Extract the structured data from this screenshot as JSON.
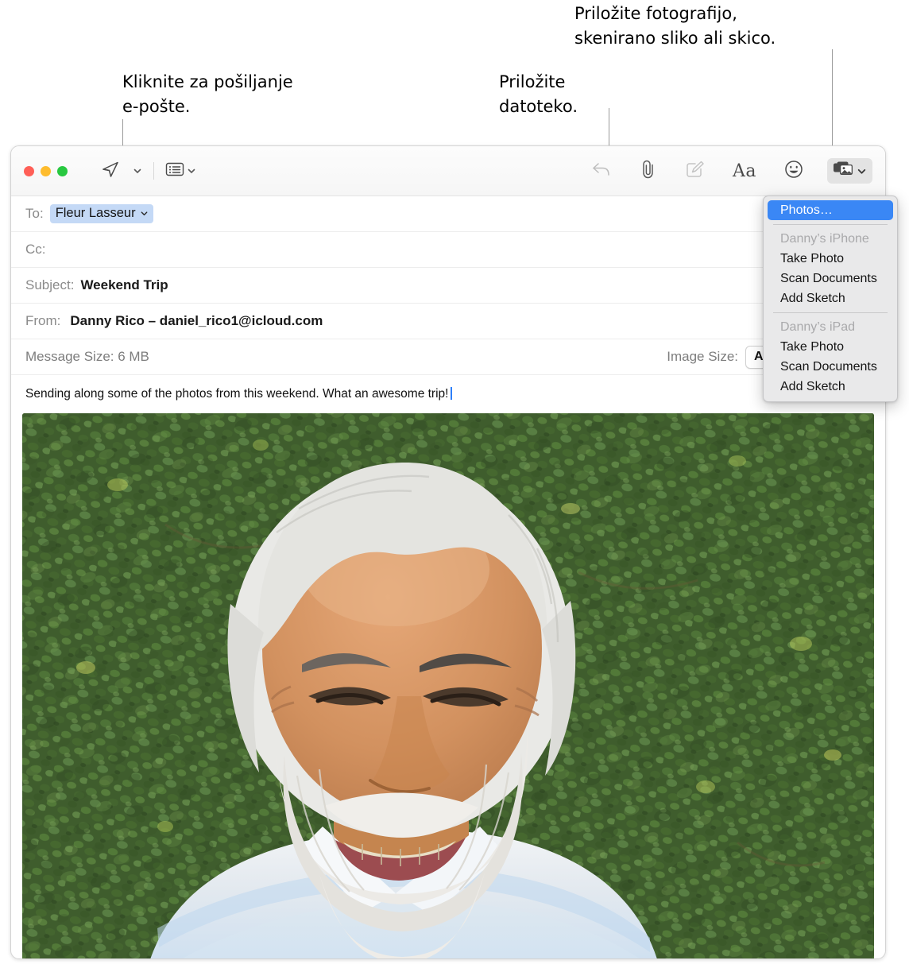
{
  "callouts": [
    {
      "id": "send",
      "text": "Kliknite za pošiljanje\ne-pošte."
    },
    {
      "id": "file",
      "text": "Priložite\ndatoteko."
    },
    {
      "id": "photo",
      "text": "Priložite fotografijo,\nskenirano sliko ali skico."
    }
  ],
  "window": {
    "traffic_lights": [
      {
        "name": "close",
        "color": "#ff5f57"
      },
      {
        "name": "minimize",
        "color": "#febc2e"
      },
      {
        "name": "zoom",
        "color": "#28c840"
      }
    ],
    "toolbar": {
      "send_icon": "send-paper-plane-icon",
      "send_chevron_icon": "chevron-down-icon",
      "stationery_icon": "stationery-list-icon",
      "stationery_chevron_icon": "chevron-down-icon",
      "reply_icon": "reply-arrow-icon",
      "attach_icon": "paperclip-icon",
      "markup_icon": "markup-pencil-icon",
      "format_label": "Aa",
      "emoji_icon": "smiley-face-icon",
      "photo_browser_icon": "photo-stack-icon",
      "photo_browser_chevron_icon": "chevron-down-icon"
    }
  },
  "compose": {
    "to": {
      "label": "To:",
      "token": "Fleur Lasseur",
      "token_chevron_icon": "chevron-down-icon"
    },
    "cc": {
      "label": "Cc:",
      "value": ""
    },
    "subject": {
      "label": "Subject:",
      "value": "Weekend Trip"
    },
    "from": {
      "label": "From:",
      "value": "Danny Rico – daniel_rico1@icloud.com"
    },
    "message_size": {
      "label": "Message Size: 6 MB"
    },
    "image_size": {
      "label": "Image Size:",
      "value": "Actual Size"
    },
    "body_text": "Sending along some of the photos from this weekend. What an awesome trip!",
    "attachment_name": "photo-attachment"
  },
  "photo_menu": {
    "items": [
      {
        "label": "Photos…",
        "type": "item",
        "selected": true
      },
      {
        "type": "separator"
      },
      {
        "label": "Danny’s iPhone",
        "type": "header"
      },
      {
        "label": "Take Photo",
        "type": "item"
      },
      {
        "label": "Scan Documents",
        "type": "item"
      },
      {
        "label": "Add Sketch",
        "type": "item"
      },
      {
        "type": "separator"
      },
      {
        "label": "Danny’s iPad",
        "type": "header"
      },
      {
        "label": "Take Photo",
        "type": "item"
      },
      {
        "label": "Scan Documents",
        "type": "item"
      },
      {
        "label": "Add Sketch",
        "type": "item"
      }
    ]
  },
  "colors": {
    "accent": "#3a87f5",
    "token_bg": "#c4d9f6",
    "menu_bg": "#e9e9ea"
  }
}
